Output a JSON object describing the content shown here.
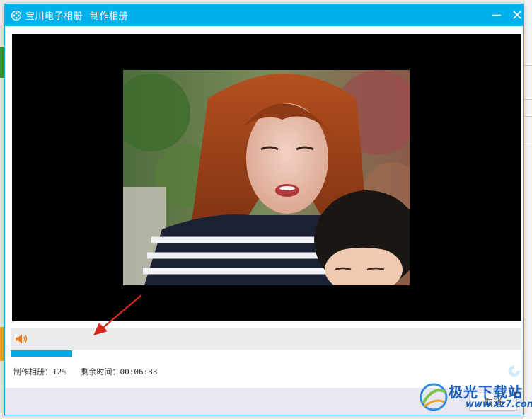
{
  "window": {
    "app_title": "宝川电子相册",
    "subtitle": "制作相册"
  },
  "progress": {
    "percent": 12,
    "label": "制作相册：",
    "value_text": "12%",
    "remaining_label": "剩余时间：",
    "remaining_value": "00:06:33"
  },
  "footer": {
    "cancel_label": "取消"
  },
  "watermark": {
    "text": "极光下载站",
    "url": "www.xz7.com"
  },
  "colors": {
    "titlebar": "#00b1ec",
    "progress_fill": "#00a8e8",
    "speaker": "#f07a1a",
    "arrow": "#d62a1e"
  }
}
